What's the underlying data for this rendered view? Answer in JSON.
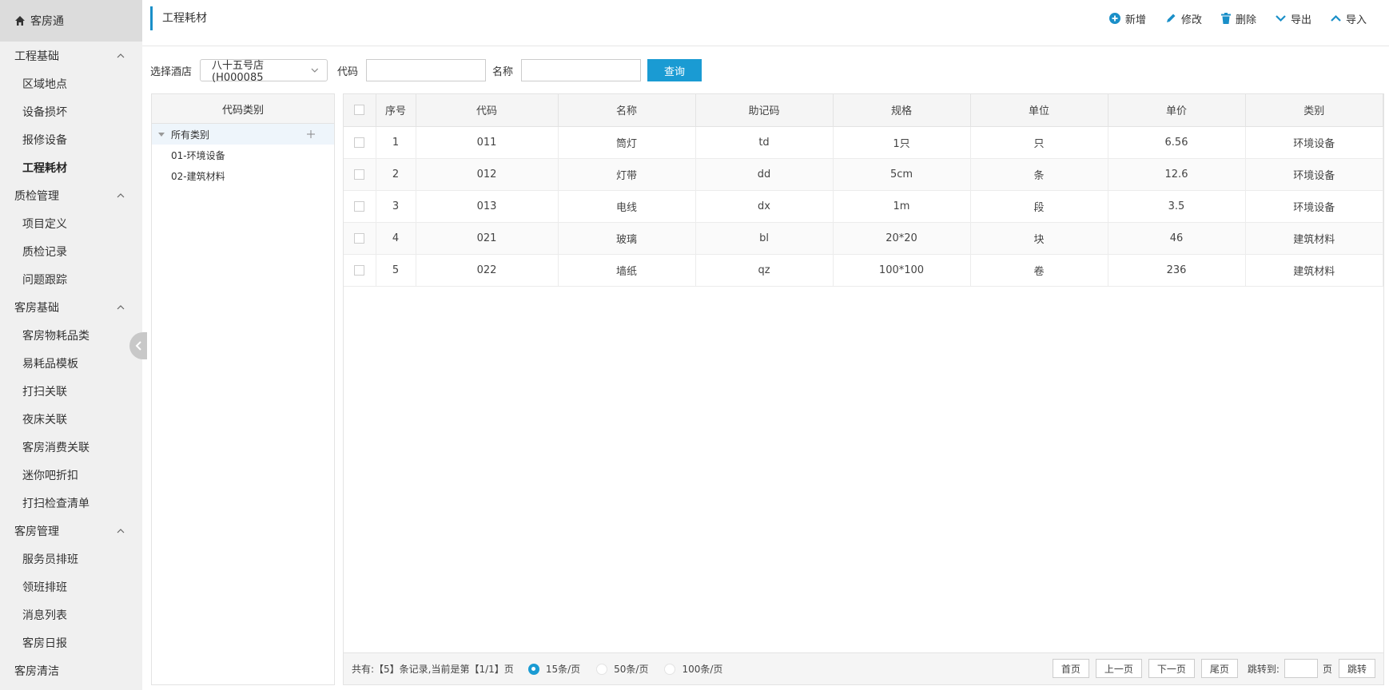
{
  "sidebar": {
    "brand": "客房通",
    "groups": [
      {
        "label": "工程基础",
        "items": [
          "区域地点",
          "设备损坏",
          "报修设备",
          "工程耗材"
        ]
      },
      {
        "label": "质检管理",
        "items": [
          "项目定义",
          "质检记录",
          "问题跟踪"
        ]
      },
      {
        "label": "客房基础",
        "items": [
          "客房物耗品类",
          "易耗品模板",
          "打扫关联",
          "夜床关联",
          "客房消费关联",
          "迷你吧折扣",
          "打扫检查清单"
        ]
      },
      {
        "label": "客房管理",
        "items": [
          "服务员排班",
          "领班排班",
          "消息列表",
          "客房日报"
        ]
      },
      {
        "label": "客房清洁",
        "items": []
      }
    ],
    "active_item": "工程耗材"
  },
  "header": {
    "title": "工程耗材",
    "actions": {
      "add": "新增",
      "edit": "修改",
      "delete": "删除",
      "export": "导出",
      "import": "导入"
    }
  },
  "filters": {
    "hotel_label": "选择酒店",
    "hotel_value": "八十五号店(H000085",
    "code_label": "代码",
    "code_value": "",
    "name_label": "名称",
    "name_value": "",
    "query_button": "查询"
  },
  "tree": {
    "header": "代码类别",
    "root": "所有类别",
    "children": [
      "01-环境设备",
      "02-建筑材料"
    ]
  },
  "table": {
    "columns": [
      "序号",
      "代码",
      "名称",
      "助记码",
      "规格",
      "单位",
      "单价",
      "类别"
    ],
    "rows": [
      [
        "1",
        "011",
        "筒灯",
        "td",
        "1只",
        "只",
        "6.56",
        "环境设备"
      ],
      [
        "2",
        "012",
        "灯带",
        "dd",
        "5cm",
        "条",
        "12.6",
        "环境设备"
      ],
      [
        "3",
        "013",
        "电线",
        "dx",
        "1m",
        "段",
        "3.5",
        "环境设备"
      ],
      [
        "4",
        "021",
        "玻璃",
        "bl",
        "20*20",
        "块",
        "46",
        "建筑材料"
      ],
      [
        "5",
        "022",
        "墙纸",
        "qz",
        "100*100",
        "卷",
        "236",
        "建筑材料"
      ]
    ]
  },
  "pager": {
    "summary": "共有:【5】条记录,当前是第【1/1】页",
    "page_sizes": [
      "15条/页",
      "50条/页",
      "100条/页"
    ],
    "selected_size": "15条/页",
    "first": "首页",
    "prev": "上一页",
    "next": "下一页",
    "last": "尾页",
    "jump_label": "跳转到:",
    "page_unit": "页",
    "jump_button": "跳转"
  },
  "colors": {
    "accent": "#1a9bd3",
    "title_bar": "#1a8fc8"
  }
}
